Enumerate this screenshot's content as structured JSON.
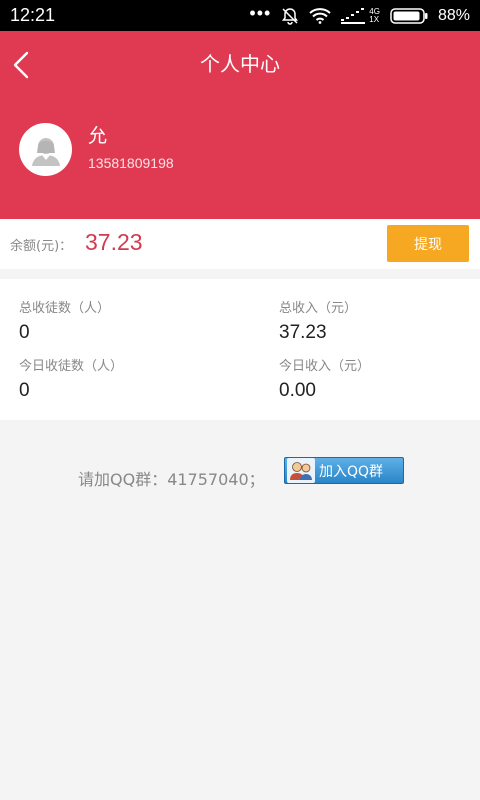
{
  "status_bar": {
    "time": "12:21",
    "network_top": "4G",
    "network_bottom": "1X",
    "battery": "88%"
  },
  "header": {
    "title": "个人中心",
    "user_name": "允",
    "user_phone": "13581809198"
  },
  "balance": {
    "label": "余额(元)：",
    "value": "37.23",
    "withdraw_label": "提现"
  },
  "stats": [
    {
      "label": "总收徒数（人）",
      "value": "0"
    },
    {
      "label": "总收入（元）",
      "value": "37.23"
    },
    {
      "label": "今日收徒数（人）",
      "value": "0"
    },
    {
      "label": "今日收入（元）",
      "value": "0.00"
    }
  ],
  "qq": {
    "text": "请加QQ群：41757040；",
    "button_label": "加入QQ群"
  },
  "colors": {
    "header_bg": "#e03a52",
    "withdraw_bg": "#f6a823",
    "balance_value": "#d23a4f"
  }
}
